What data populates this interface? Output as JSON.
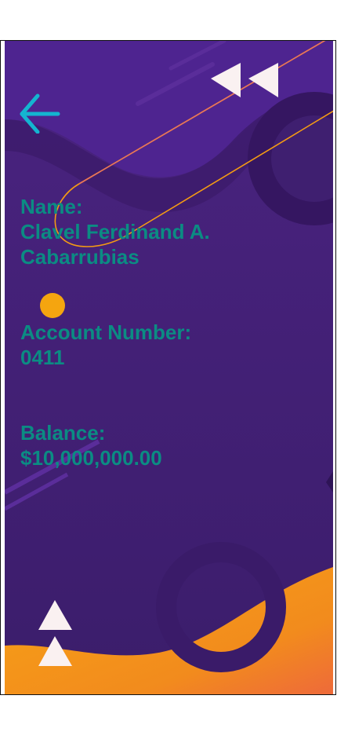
{
  "account": {
    "name_label": "Name:",
    "name_line1": "Clavel Ferdinand A.",
    "name_line2": "Cabarrubias",
    "number_label": "Account Number:",
    "number_value": "0411",
    "balance_label": "Balance:",
    "balance_value": "$10,000,000.00"
  },
  "icons": {
    "back": "arrow-left-icon"
  },
  "colors": {
    "background": "#3f1f70",
    "text": "#0b8c83",
    "accent_orange": "#f39a14",
    "arrow": "#14b4d0"
  }
}
